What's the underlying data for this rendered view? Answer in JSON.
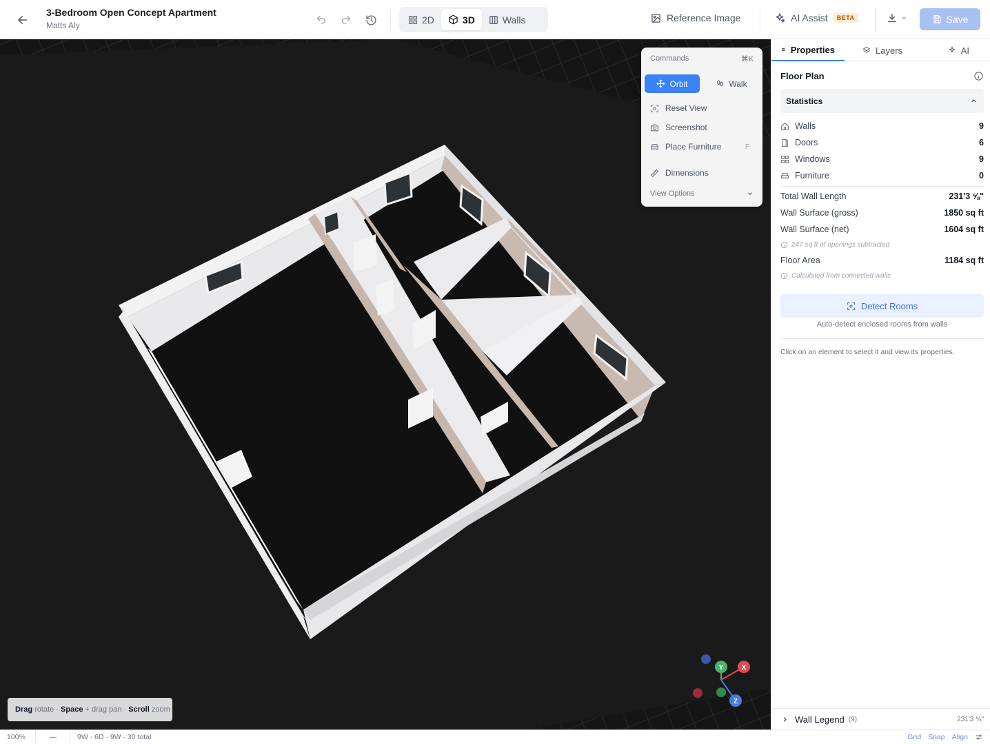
{
  "header": {
    "project_title": "3-Bedroom Open Concept Apartment",
    "owner": "Matts Aly",
    "view_modes": [
      {
        "label": "2D",
        "icon": "grid-icon"
      },
      {
        "label": "3D",
        "icon": "cube-icon"
      },
      {
        "label": "Walls",
        "icon": "columns-icon"
      }
    ],
    "active_view": "3D",
    "reference_image_label": "Reference Image",
    "ai_assist_label": "AI Assist",
    "beta_badge": "BETA",
    "save_label": "Save"
  },
  "commands": {
    "title": "Commands",
    "shortcut": "⌘K",
    "modes": [
      {
        "label": "Orbit",
        "active": true
      },
      {
        "label": "Walk",
        "active": false
      }
    ],
    "items": [
      {
        "label": "Reset View",
        "icon": "focus-icon",
        "kbd": ""
      },
      {
        "label": "Screenshot",
        "icon": "camera-icon",
        "kbd": ""
      },
      {
        "label": "Place Furniture",
        "icon": "sofa-icon",
        "kbd": "F"
      },
      {
        "label": "Dimensions",
        "icon": "ruler-icon",
        "kbd": ""
      }
    ],
    "view_options": "View Options"
  },
  "hint": {
    "drag": "Drag",
    "rotate": "rotate ·",
    "space": "Space",
    "drag_pan": "+ drag pan ·",
    "scroll": "Scroll",
    "zoom": "zoom"
  },
  "gizmo": {
    "x": "X",
    "y": "Y",
    "z": "Z"
  },
  "sidebar": {
    "tabs": [
      {
        "label": "Properties",
        "icon": "sliders-icon"
      },
      {
        "label": "Layers",
        "icon": "layers-icon"
      },
      {
        "label": "AI",
        "icon": "sparkle-icon"
      }
    ],
    "section_title": "Floor Plan",
    "statistics_label": "Statistics",
    "counts": [
      {
        "label": "Walls",
        "value": "9",
        "icon": "home-icon"
      },
      {
        "label": "Doors",
        "value": "6",
        "icon": "door-icon"
      },
      {
        "label": "Windows",
        "value": "9",
        "icon": "window-icon"
      },
      {
        "label": "Furniture",
        "value": "0",
        "icon": "sofa-icon"
      }
    ],
    "total_wall_length_label": "Total Wall Length",
    "total_wall_length": "231'3 ⅝\"",
    "wall_surface_gross_label": "Wall Surface (gross)",
    "wall_surface_gross": "1850 sq ft",
    "wall_surface_net_label": "Wall Surface (net)",
    "wall_surface_net": "1604 sq ft",
    "openings_note": "247 sq ft of openings subtracted",
    "floor_area_label": "Floor Area",
    "floor_area": "1184 sq ft",
    "floor_area_note": "Calculated from connected walls",
    "detect_rooms_label": "Detect Rooms",
    "detect_rooms_sub": "Auto-detect enclosed rooms from walls",
    "click_hint": "Click on an element to select it and view its properties.",
    "legend_label": "Wall Legend",
    "legend_count": "(9)",
    "legend_length": "231'3 ⅝\""
  },
  "statusbar": {
    "zoom": "100%",
    "dash": "—",
    "summary": "9W · 6D · 9W · 30 total",
    "grid": "Grid",
    "snap": "Snap",
    "align": "Align"
  },
  "colors": {
    "accent": "#3b82f6",
    "scene_bg": "#151515",
    "wall": "#ecebed",
    "wall_shade": "#c4b5ab"
  }
}
